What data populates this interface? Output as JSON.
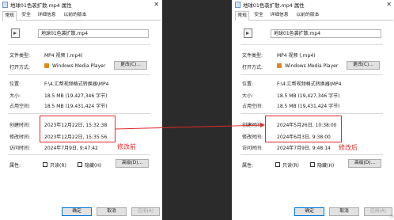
{
  "colors": {
    "accent_red": "#e02b2b",
    "divider_dark": "#2b2b2b"
  },
  "left": {
    "title": "地球01色袭扩散.mp4 属性",
    "tabs": [
      "常规",
      "安全",
      "详细信息",
      "以前的版本"
    ],
    "filename": "地球01色袭扩散.mp4",
    "labels": {
      "type": "文件类型:",
      "opens": "打开方式:",
      "location": "位置:",
      "size": "大小:",
      "disk": "占用空间:",
      "created": "创建时间:",
      "modified": "修改时间:",
      "accessed": "访问时间:",
      "attributes": "属性:"
    },
    "values": {
      "type": "MP4 视频 (.mp4)",
      "app": "Windows Media Player",
      "location": "F:\\4.汇帮视频格式转换器\\MP4",
      "size": "18.5 MB (19,427,346 字节)",
      "disk": "18.5 MB (19,431,424 字节)",
      "created": "2023年12月22日, 15:32:38",
      "modified": "2023年12月22日, 15:35:56",
      "accessed": "2024年7月9日, 9:47:42"
    },
    "change_btn": "更改(C)...",
    "readonly": "只读(R)",
    "hidden": "隐藏(H)",
    "advanced_btn": "高级(D)...",
    "ok_btn": "确定",
    "cancel_btn": "取消",
    "apply_btn": "应用(A)",
    "note": "修改前"
  },
  "right": {
    "title": "地球01色袭扩散.mp4 属性",
    "tabs": [
      "常规",
      "安全",
      "详细信息",
      "以前的版本"
    ],
    "filename": "地球01色袭扩散.mp4",
    "labels": {
      "type": "文件类型:",
      "opens": "打开方式:",
      "location": "位置:",
      "size": "大小:",
      "disk": "占用空间:",
      "created": "创建时间:",
      "modified": "修改时间:",
      "accessed": "访问时间:",
      "attributes": "属性:"
    },
    "values": {
      "type": "MP4 视频 (.mp4)",
      "app": "Windows Media Player",
      "location": "F:\\4.汇帮视频格式转换器\\MP4",
      "size": "18.5 MB (19,427,346 字节)",
      "disk": "18.5 MB (19,431,424 字节)",
      "created": "2024年5月26日, 10:38:00",
      "modified": "2024年6月3日, 9:38:00",
      "accessed": "2024年7月9日, 9:48:14"
    },
    "change_btn": "更改(C)...",
    "readonly": "只读(R)",
    "hidden": "隐藏(H)",
    "advanced_btn": "高级(D)...",
    "ok_btn": "确定",
    "cancel_btn": "取消",
    "apply_btn": "应用(A)",
    "note": "修改后"
  }
}
